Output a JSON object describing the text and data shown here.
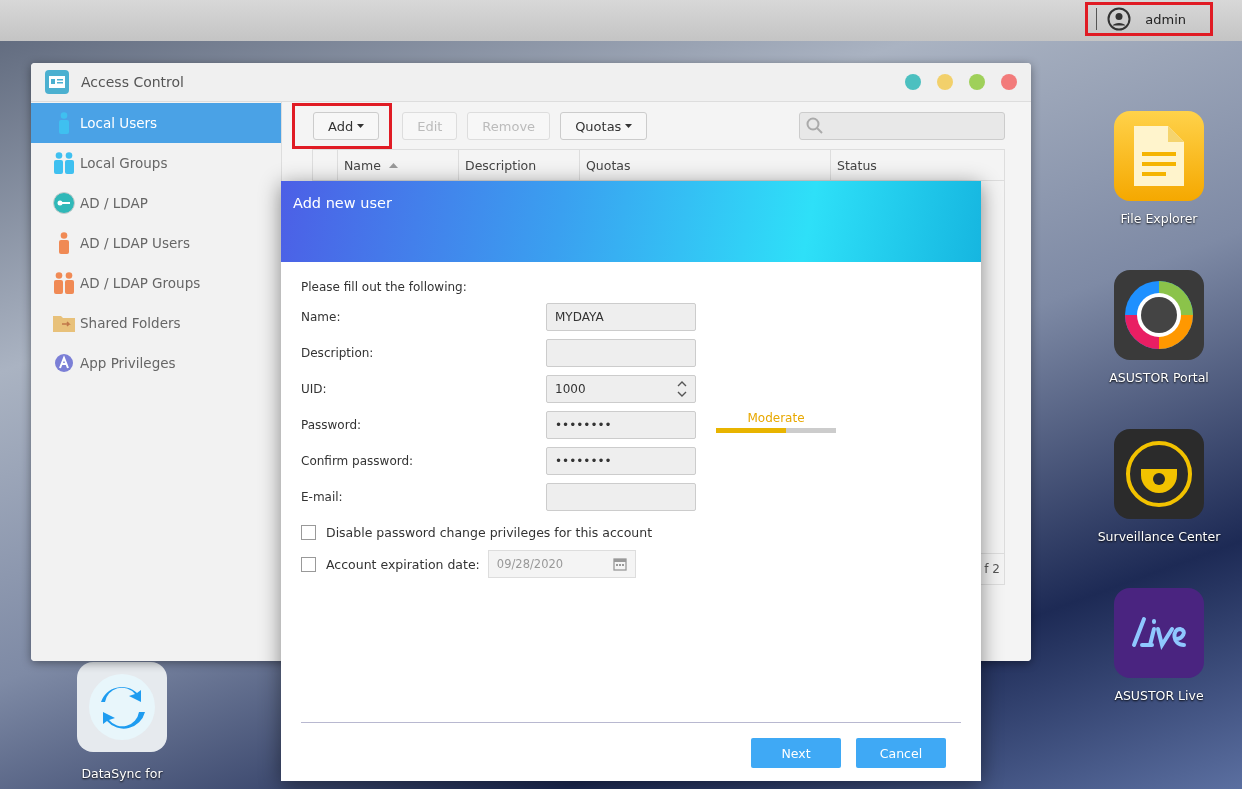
{
  "top_bar": {
    "user": "admin",
    "highlighted": true
  },
  "desktop_icons": [
    {
      "label": "File Explorer",
      "kind": "file"
    },
    {
      "label": "ASUSTOR Portal",
      "kind": "portal"
    },
    {
      "label": "Surveillance Center",
      "kind": "camera"
    },
    {
      "label": "ASUSTOR Live",
      "kind": "live"
    }
  ],
  "desktop_left_icon": {
    "label": "DataSync for",
    "kind": "sync"
  },
  "window": {
    "title": "Access Control",
    "sidebar": [
      {
        "label": "Local Users",
        "kind": "user",
        "selected": true
      },
      {
        "label": "Local Groups",
        "kind": "group",
        "selected": false
      },
      {
        "label": "AD / LDAP",
        "kind": "key",
        "selected": false
      },
      {
        "label": "AD / LDAP Users",
        "kind": "user-orange",
        "selected": false
      },
      {
        "label": "AD / LDAP Groups",
        "kind": "group-orange",
        "selected": false
      },
      {
        "label": "Shared Folders",
        "kind": "folder",
        "selected": false
      },
      {
        "label": "App Privileges",
        "kind": "app",
        "selected": false
      }
    ],
    "toolbar": [
      {
        "label": "Add",
        "dropdown": true,
        "disabled": false,
        "highlighted": true
      },
      {
        "label": "Edit",
        "dropdown": false,
        "disabled": true,
        "highlighted": false
      },
      {
        "label": "Remove",
        "dropdown": false,
        "disabled": true,
        "highlighted": false
      },
      {
        "label": "Quotas",
        "dropdown": true,
        "disabled": false,
        "highlighted": false
      }
    ],
    "table": {
      "columns": [
        {
          "label": "Name",
          "sorted": true
        },
        {
          "label": "Description",
          "sorted": false
        },
        {
          "label": "Quotas",
          "sorted": false
        },
        {
          "label": "Status",
          "sorted": false
        }
      ]
    },
    "pagination": "f 2"
  },
  "dialog": {
    "title": "Add new user",
    "intro": "Please fill out the following:",
    "fields": [
      {
        "label": "Name:",
        "value": "MYDAYA",
        "kind": "text"
      },
      {
        "label": "Description:",
        "kind": "text"
      },
      {
        "label": "UID:",
        "value": "1000",
        "kind": "spin"
      },
      {
        "label": "Password:",
        "value": "••••••••",
        "kind": "password"
      },
      {
        "label": "Confirm password:",
        "value": "••••••••",
        "kind": "password"
      },
      {
        "label": "E-mail:",
        "kind": "text"
      }
    ],
    "strength": {
      "label": "Moderate",
      "level": 0.58
    },
    "options": [
      {
        "label": "Disable password change privileges for this account",
        "checked": false
      },
      {
        "label": "Account expiration date:",
        "checked": false,
        "date": "09/28/2020"
      }
    ],
    "buttons": [
      "Next",
      "Cancel"
    ]
  }
}
